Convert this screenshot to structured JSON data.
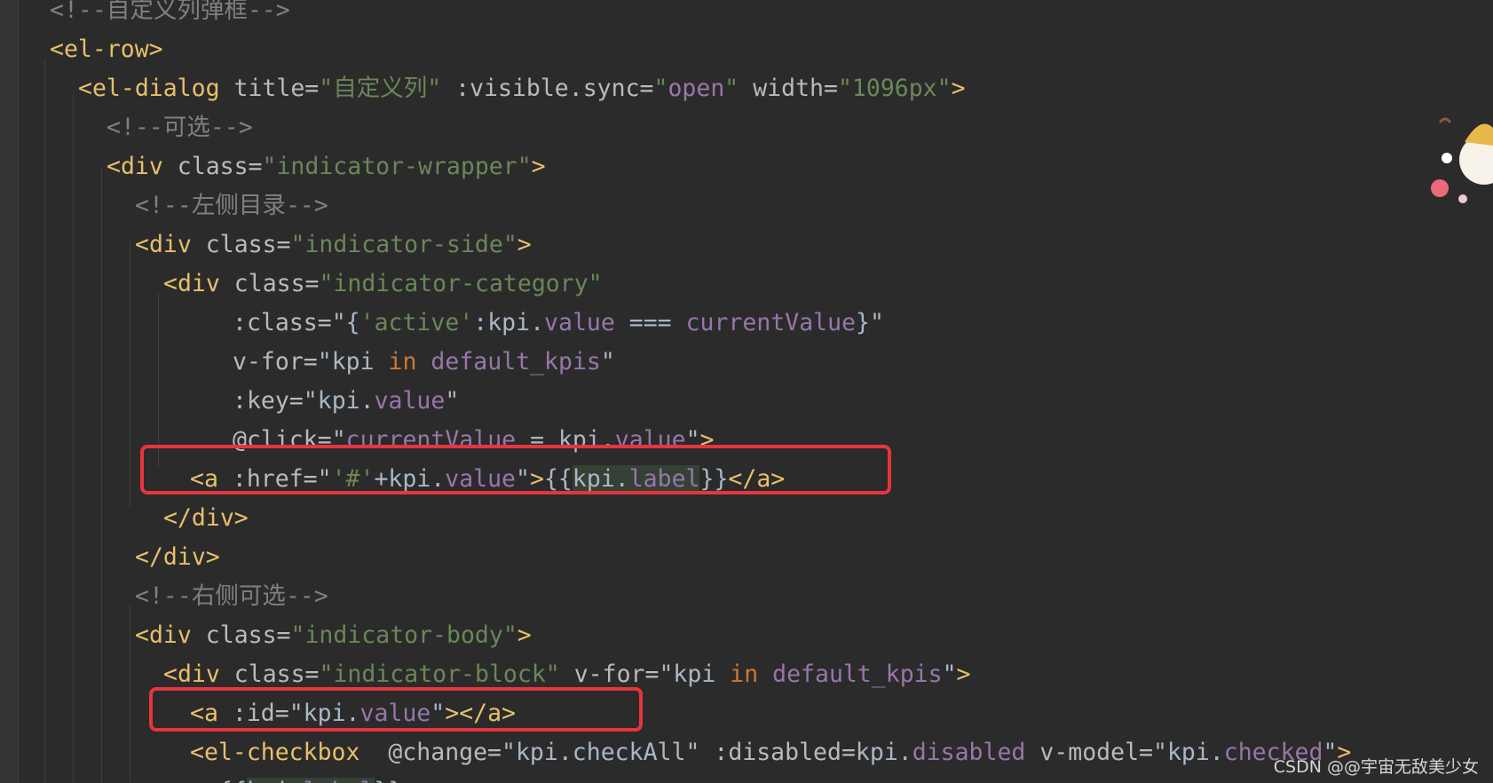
{
  "editor": {
    "lines": [
      [
        {
          "t": "<!--自定义列弹框-->",
          "c": "comment"
        }
      ],
      [
        {
          "t": "<el-row>",
          "c": "tag"
        }
      ],
      [
        {
          "t": "<el-dialog ",
          "c": "tag"
        },
        {
          "t": "title=",
          "c": "attr"
        },
        {
          "t": "\"",
          "c": "str"
        },
        {
          "t": "自定义列",
          "c": "str"
        },
        {
          "t": "\" ",
          "c": "str"
        },
        {
          "t": ":visible.sync=",
          "c": "attr"
        },
        {
          "t": "\"",
          "c": "str"
        },
        {
          "t": "open",
          "c": "prop"
        },
        {
          "t": "\" ",
          "c": "str"
        },
        {
          "t": "width=",
          "c": "attr"
        },
        {
          "t": "\"1096px\"",
          "c": "str"
        },
        {
          "t": ">",
          "c": "tag"
        }
      ],
      [
        {
          "t": "<!--可选-->",
          "c": "comment"
        }
      ],
      [
        {
          "t": "<div ",
          "c": "tag"
        },
        {
          "t": "class=",
          "c": "attr"
        },
        {
          "t": "\"indicator-wrapper\"",
          "c": "str"
        },
        {
          "t": ">",
          "c": "tag"
        }
      ],
      [
        {
          "t": "<!--左侧目录-->",
          "c": "comment"
        }
      ],
      [
        {
          "t": "<div ",
          "c": "tag"
        },
        {
          "t": "class=",
          "c": "attr"
        },
        {
          "t": "\"indicator-side\"",
          "c": "str"
        },
        {
          "t": ">",
          "c": "tag"
        }
      ],
      [
        {
          "t": "<div ",
          "c": "tag"
        },
        {
          "t": "class=",
          "c": "attr"
        },
        {
          "t": "\"indicator-category\"",
          "c": "str"
        }
      ],
      [
        {
          "t": ":class=",
          "c": "attr"
        },
        {
          "t": "\"{",
          "c": "plain"
        },
        {
          "t": "'active'",
          "c": "lit"
        },
        {
          "t": ":kpi.",
          "c": "plain"
        },
        {
          "t": "value",
          "c": "prop"
        },
        {
          "t": " === ",
          "c": "plain"
        },
        {
          "t": "currentValue",
          "c": "prop"
        },
        {
          "t": "}\"",
          "c": "plain"
        }
      ],
      [
        {
          "t": "v-for=",
          "c": "attr"
        },
        {
          "t": "\"kpi ",
          "c": "plain"
        },
        {
          "t": "in",
          "c": "kw"
        },
        {
          "t": " ",
          "c": "plain"
        },
        {
          "t": "default_kpis",
          "c": "prop"
        },
        {
          "t": "\"",
          "c": "plain"
        }
      ],
      [
        {
          "t": ":key=",
          "c": "attr"
        },
        {
          "t": "\"kpi.",
          "c": "plain"
        },
        {
          "t": "value",
          "c": "prop"
        },
        {
          "t": "\"",
          "c": "plain"
        }
      ],
      [
        {
          "t": "@click=",
          "c": "attr"
        },
        {
          "t": "\"",
          "c": "plain"
        },
        {
          "t": "currentValue",
          "c": "prop"
        },
        {
          "t": " = kpi.",
          "c": "plain"
        },
        {
          "t": "value",
          "c": "prop"
        },
        {
          "t": "\"",
          "c": "plain"
        },
        {
          "t": ">",
          "c": "tag"
        }
      ],
      [
        {
          "t": "<a ",
          "c": "tag"
        },
        {
          "t": ":href=",
          "c": "attr"
        },
        {
          "t": "\"",
          "c": "plain"
        },
        {
          "t": "'#'",
          "c": "lit"
        },
        {
          "t": "+kpi.",
          "c": "plain"
        },
        {
          "t": "value",
          "c": "prop"
        },
        {
          "t": "\"",
          "c": "plain"
        },
        {
          "t": ">",
          "c": "tag"
        },
        {
          "t": "{{",
          "c": "plain"
        },
        {
          "t": "kpi.",
          "c": "plain",
          "hl": true
        },
        {
          "t": "label",
          "c": "prop",
          "hl": true
        },
        {
          "t": "}}",
          "c": "plain"
        },
        {
          "t": "</a>",
          "c": "tag"
        }
      ],
      [
        {
          "t": "</div>",
          "c": "tag"
        }
      ],
      [
        {
          "t": "</div>",
          "c": "tag"
        }
      ],
      [
        {
          "t": "<!--右侧可选-->",
          "c": "comment"
        }
      ],
      [
        {
          "t": "<div ",
          "c": "tag"
        },
        {
          "t": "class=",
          "c": "attr"
        },
        {
          "t": "\"indicator-body\"",
          "c": "str"
        },
        {
          "t": ">",
          "c": "tag"
        }
      ],
      [
        {
          "t": "<div ",
          "c": "tag"
        },
        {
          "t": "class=",
          "c": "attr"
        },
        {
          "t": "\"indicator-block\"",
          "c": "str"
        },
        {
          "t": " ",
          "c": "plain"
        },
        {
          "t": "v-for=",
          "c": "attr"
        },
        {
          "t": "\"kpi ",
          "c": "plain"
        },
        {
          "t": "in",
          "c": "kw"
        },
        {
          "t": " ",
          "c": "plain"
        },
        {
          "t": "default_kpis",
          "c": "prop"
        },
        {
          "t": "\"",
          "c": "plain"
        },
        {
          "t": ">",
          "c": "tag"
        }
      ],
      [
        {
          "t": "<a ",
          "c": "tag"
        },
        {
          "t": ":id=",
          "c": "attr"
        },
        {
          "t": "\"kpi.",
          "c": "plain"
        },
        {
          "t": "value",
          "c": "prop"
        },
        {
          "t": "\"",
          "c": "plain"
        },
        {
          "t": "></a>",
          "c": "tag"
        }
      ],
      [
        {
          "t": "<el-checkbox  ",
          "c": "tag"
        },
        {
          "t": "@change=",
          "c": "attr"
        },
        {
          "t": "\"kpi.",
          "c": "plain"
        },
        {
          "t": "checkAll",
          "c": "plain"
        },
        {
          "t": "\" ",
          "c": "plain"
        },
        {
          "t": ":disabled=",
          "c": "attr"
        },
        {
          "t": "kpi.",
          "c": "plain"
        },
        {
          "t": "disabled",
          "c": "prop"
        },
        {
          "t": " ",
          "c": "plain"
        },
        {
          "t": "v-model=",
          "c": "attr"
        },
        {
          "t": "\"kpi.",
          "c": "plain"
        },
        {
          "t": "checked",
          "c": "prop"
        },
        {
          "t": "\"",
          "c": "plain"
        },
        {
          "t": ">",
          "c": "tag"
        }
      ],
      [
        {
          "t": "{{",
          "c": "plain"
        },
        {
          "t": "kpi.",
          "c": "plain",
          "hl": true
        },
        {
          "t": "label",
          "c": "prop",
          "hl": true
        },
        {
          "t": "}}",
          "c": "plain"
        }
      ]
    ]
  },
  "highlights": [
    "line-13-box",
    "line-19-box"
  ],
  "watermark": "CSDN @@宇宙无敌美少女",
  "colors": {
    "background": "#2b2b2b",
    "tag": "#e8bf6a",
    "string": "#6a8759",
    "property": "#9876aa",
    "keyword": "#cc7832",
    "comment": "#808080",
    "highlight_border": "#e8343c"
  }
}
